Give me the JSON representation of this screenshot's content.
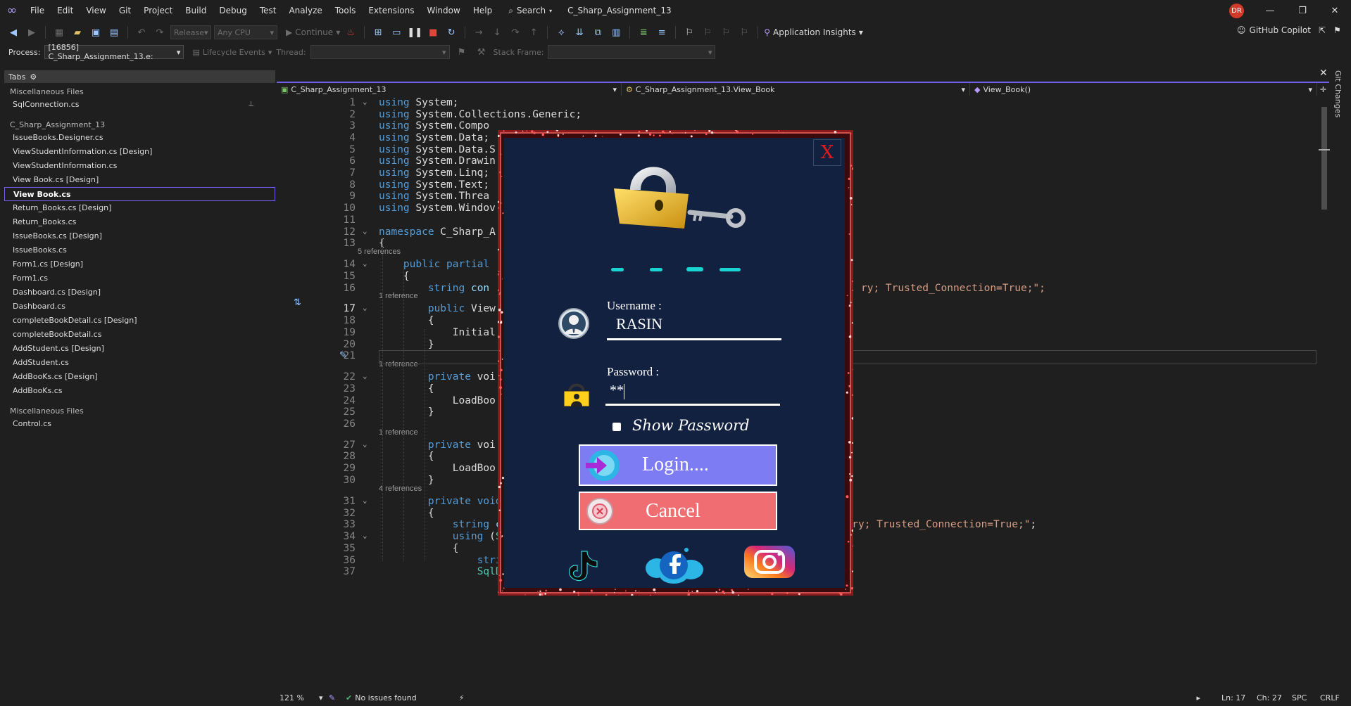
{
  "menu": [
    "File",
    "Edit",
    "View",
    "Git",
    "Project",
    "Build",
    "Debug",
    "Test",
    "Analyze",
    "Tools",
    "Extensions",
    "Window",
    "Help"
  ],
  "search_label": "Search",
  "solution_title": "C_Sharp_Assignment_13",
  "avatar_initials": "DR",
  "toolbar": {
    "config": "Release",
    "platform": "Any CPU",
    "continue_label": "Continue",
    "app_insights": "Application Insights",
    "copilot": "GitHub Copilot"
  },
  "toolbar2": {
    "process_label": "Process:",
    "process_value": "[16856] C_Sharp_Assignment_13.e:",
    "lifecycle": "Lifecycle Events",
    "thread_label": "Thread:",
    "stack_label": "Stack Frame:"
  },
  "tabs_panel": {
    "header": "Tabs",
    "groups": [
      {
        "title": "Miscellaneous Files",
        "items": [
          "SqlConnection.cs"
        ]
      },
      {
        "title": "C_Sharp_Assignment_13",
        "items": [
          "IssueBooks.Designer.cs",
          "ViewStudentInformation.cs [Design]",
          "ViewStudentInformation.cs",
          "View Book.cs [Design]",
          "View Book.cs",
          "Return_Books.cs [Design]",
          "Return_Books.cs",
          "IssueBooks.cs [Design]",
          "IssueBooks.cs",
          "Form1.cs [Design]",
          "Form1.cs",
          "Dashboard.cs [Design]",
          "Dashboard.cs",
          "completeBookDetail.cs [Design]",
          "completeBookDetail.cs",
          "AddStudent.cs [Design]",
          "AddStudent.cs",
          "AddBooKs.cs [Design]",
          "AddBooKs.cs"
        ]
      },
      {
        "title": "Miscellaneous Files",
        "items": [
          "Control.cs"
        ]
      }
    ],
    "active_item": "View Book.cs"
  },
  "editor_nav": {
    "project": "C_Sharp_Assignment_13",
    "class": "C_Sharp_Assignment_13.View_Book",
    "member": "View_Book()"
  },
  "git_changes": "Git Changes",
  "code_lines": [
    {
      "n": "1",
      "t": "using System;"
    },
    {
      "n": "2",
      "t": "using System.Collections.Generic;"
    },
    {
      "n": "3",
      "t": "using System.Compo"
    },
    {
      "n": "4",
      "t": "using System.Data;"
    },
    {
      "n": "5",
      "t": "using System.Data.S"
    },
    {
      "n": "6",
      "t": "using System.Drawin"
    },
    {
      "n": "7",
      "t": "using System.Linq;"
    },
    {
      "n": "8",
      "t": "using System.Text;"
    },
    {
      "n": "9",
      "t": "using System.Threa"
    },
    {
      "n": "10",
      "t": "using System.Windov"
    },
    {
      "n": "11",
      "t": ""
    },
    {
      "n": "12",
      "t": "namespace C_Sharp_A"
    },
    {
      "n": "13",
      "t": "{"
    },
    {
      "n": "14",
      "t": "    public partial"
    },
    {
      "n": "15",
      "t": "    {"
    },
    {
      "n": "16",
      "t": "        string con"
    },
    {
      "n": "17",
      "t": "        public View"
    },
    {
      "n": "18",
      "t": "        {"
    },
    {
      "n": "19",
      "t": "            Initial"
    },
    {
      "n": "20",
      "t": "        }"
    },
    {
      "n": "21",
      "t": ""
    },
    {
      "n": "22",
      "t": "        private voi"
    },
    {
      "n": "23",
      "t": "        {"
    },
    {
      "n": "24",
      "t": "            LoadBoo"
    },
    {
      "n": "25",
      "t": "        }"
    },
    {
      "n": "26",
      "t": ""
    },
    {
      "n": "27",
      "t": "        private voi"
    },
    {
      "n": "28",
      "t": "        {"
    },
    {
      "n": "29",
      "t": "            LoadBoo"
    },
    {
      "n": "30",
      "t": "        }"
    },
    {
      "n": "31",
      "t": "        private void LoadBooks()"
    },
    {
      "n": "32",
      "t": "        {"
    },
    {
      "n": "33",
      "t": "            string connectionString = \"Server=DESKTOP-UEQEMOD; Database=library; Trusted_Connection=True;\";"
    },
    {
      "n": "34",
      "t": "            using (SqlConnection con = new SqlConnection(connectionString))"
    },
    {
      "n": "35",
      "t": "            {"
    },
    {
      "n": "36",
      "t": "                string query = \"SELECT * FROM NewBook\";"
    },
    {
      "n": "37",
      "t": "                SqlDataAdapter da = new SqlDataAdapter(query, con);"
    }
  ],
  "line16_tail": "ry; Trusted_Connection=True;\";",
  "lens": {
    "l14": "5 references",
    "l17": "1 reference",
    "l22": "1 reference",
    "l27": "1 reference",
    "l31": "4 references"
  },
  "status": {
    "zoom": "121 %",
    "issues": "No issues found",
    "ln": "Ln: 17",
    "ch": "Ch: 27",
    "spc": "SPC",
    "crlf": "CRLF"
  },
  "dialog": {
    "close": "X",
    "username_label": "Username :",
    "username_value": "RASIN",
    "password_label": "Password :",
    "password_value": "**",
    "show_password": "Show Password",
    "login": "Login....",
    "cancel": "Cancel"
  },
  "colors": {
    "accent": "#7160e8",
    "dialog_bg": "#132140",
    "login_bg": "#7d7cf2",
    "cancel_bg": "#f06e72"
  }
}
